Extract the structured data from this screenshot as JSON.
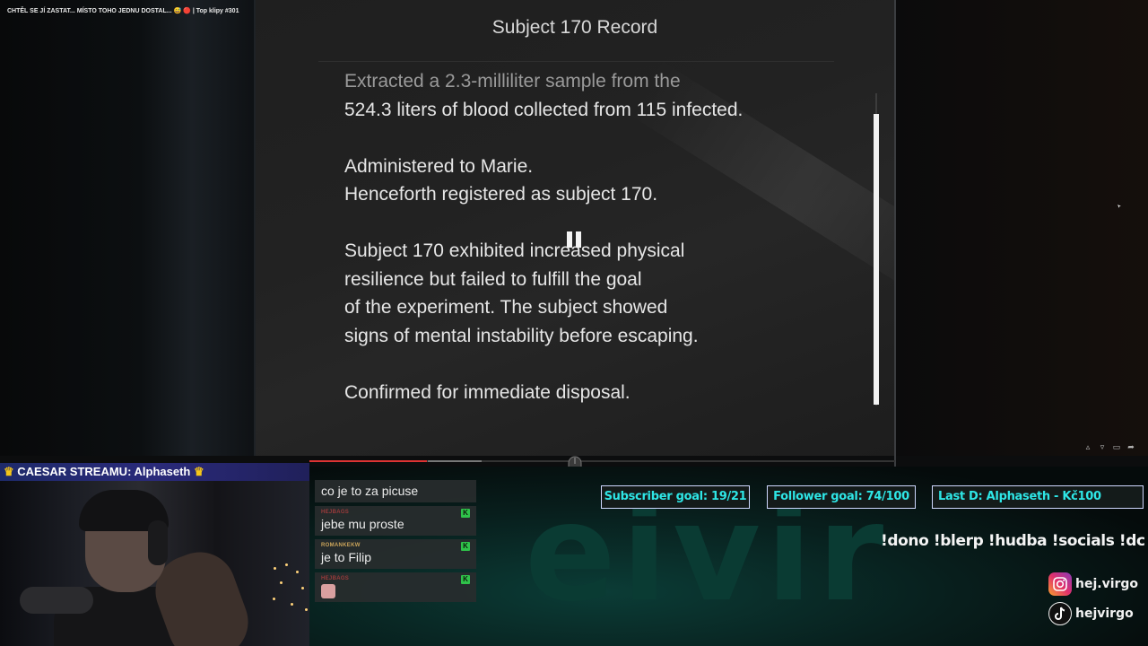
{
  "video_title": "CHTĚL SE JÍ ZASTAT... MÍSTO TOHO JEDNU DOSTAL... 😅 🔴 | Top klipy #301",
  "document": {
    "title": "Subject 170 Record",
    "faded_line": "Extracted a 2.3-milliliter sample from the",
    "lines_1": "524.3 liters of blood collected from 115 infected.",
    "para_2a": "Administered to Marie.",
    "para_2b": "Henceforth registered as subject 170.",
    "para_3a": "Subject 170 exhibited increased physical",
    "para_3b": "resilience but failed to fulfill the goal",
    "para_3c": "of the experiment. The subject showed",
    "para_3d": "signs of mental instability before escaping.",
    "para_4": "Confirmed for immediate disposal."
  },
  "playback": {
    "progress": 0.2
  },
  "caesar": {
    "text": "CAESAR STREAMU: Alphaseth"
  },
  "chat": [
    {
      "user": "",
      "text": "co je to za picuse",
      "badge": false
    },
    {
      "user": "HEJBAGS",
      "text": "jebe mu proste",
      "badge": true
    },
    {
      "user": "ROMANKEKW",
      "text": "je to Filip",
      "badge": true
    },
    {
      "user": "HEJBAGS",
      "text": "",
      "badge": true,
      "emote": true
    }
  ],
  "goals": {
    "subscriber": "Subscriber goal: 19/21",
    "follower": "Follower goal: 74/100",
    "last_donation": "Last D: Alphaseth - Kč100"
  },
  "commands": "!dono !blerp !hudba !socials !dc",
  "socials": {
    "instagram": "hej.virgo",
    "tiktok": "hejvirgo"
  },
  "colors": {
    "goal_text": "#2ee6e6",
    "progress": "#dd3333",
    "chat_badge": "#2fc24a",
    "caesar_bar": "#2a2a7a"
  },
  "icons": [
    "pause-icon",
    "mouse-icon",
    "like-icon",
    "dislike-icon",
    "comment-icon",
    "share-icon",
    "toggle-icon",
    "captions-icon",
    "settings-icon",
    "fullscreen-icon",
    "instagram-icon",
    "tiktok-icon",
    "crown-icon"
  ]
}
